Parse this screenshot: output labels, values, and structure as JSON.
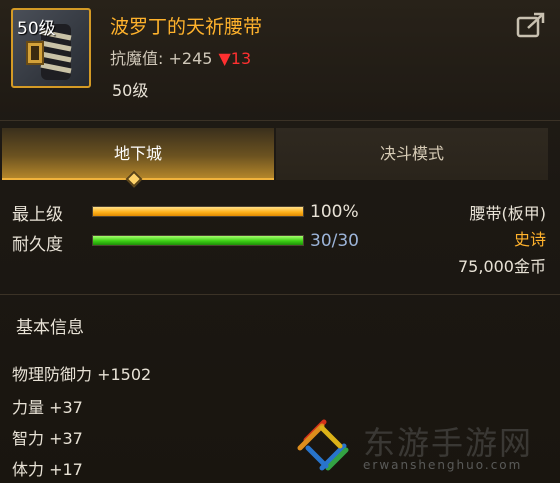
{
  "item": {
    "icon_level": "50级",
    "name": "波罗丁的天祈腰带",
    "stat_label": "抗魔值:",
    "stat_value": "+245",
    "stat_change": "▼13",
    "level": "50级"
  },
  "tabs": [
    {
      "label": "地下城",
      "active": true
    },
    {
      "label": "决斗模式",
      "active": false
    }
  ],
  "bars": [
    {
      "label": "最上级",
      "value_text": "100%",
      "fill": 1.0
    },
    {
      "label": "耐久度",
      "value_text": "30/30",
      "fill": 1.0
    }
  ],
  "side": {
    "type": "腰带(板甲)",
    "rarity": "史诗",
    "price": "75,000金币"
  },
  "basic": {
    "title": "基本信息",
    "attributes": [
      "物理防御力 +1502",
      "力量 +37",
      "智力 +37",
      "体力 +17"
    ]
  },
  "watermark": {
    "text": "东游手游网",
    "subtext": "erwanshenghuo.com"
  },
  "colors": {
    "item_name": "#ffb22c",
    "rarity": "#ffb22c",
    "stat_down": "#ff3030",
    "bar_orange": "#ffb31d",
    "bar_green": "#3ccf14"
  }
}
